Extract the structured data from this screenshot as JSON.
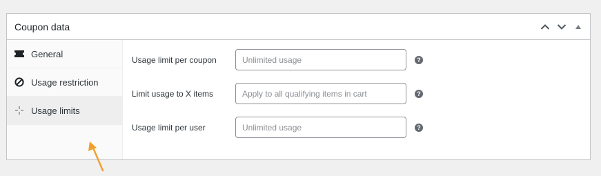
{
  "panel": {
    "title": "Coupon data",
    "controls": [
      "chevron-up-icon",
      "chevron-down-icon",
      "triangle-up-icon"
    ]
  },
  "tabs": [
    {
      "label": "General",
      "icon": "ticket-icon",
      "active": false
    },
    {
      "label": "Usage restriction",
      "icon": "ban-icon",
      "active": false
    },
    {
      "label": "Usage limits",
      "icon": "crosshair-icon",
      "active": true
    }
  ],
  "fields": [
    {
      "label": "Usage limit per coupon",
      "placeholder": "Unlimited usage",
      "value": ""
    },
    {
      "label": "Limit usage to X items",
      "placeholder": "Apply to all qualifying items in cart",
      "value": ""
    },
    {
      "label": "Usage limit per user",
      "placeholder": "Unlimited usage",
      "value": ""
    }
  ],
  "help_glyph": "?",
  "colors": {
    "background": "#f0f0f1",
    "border": "#c3c4c7",
    "active_tab": "#eeeeee",
    "annotation_arrow": "#f0a030",
    "help_icon": "#646970"
  }
}
